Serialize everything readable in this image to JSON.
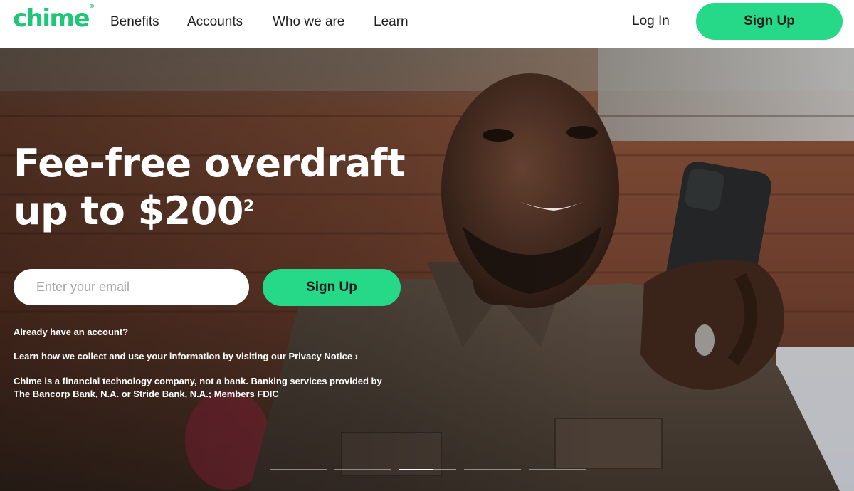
{
  "brand": {
    "logo_text": "chime",
    "logo_mark": "®",
    "accent_color": "#25d989"
  },
  "nav": {
    "links": [
      "Benefits",
      "Accounts",
      "Who we are",
      "Learn"
    ],
    "login_label": "Log In",
    "signup_label": "Sign Up"
  },
  "hero": {
    "headline_line1": "Fee-free overdraft",
    "headline_line2": "up to $200",
    "headline_footnote": "2",
    "email_placeholder": "Enter your email",
    "signup_label": "Sign Up",
    "already_account": "Already have an account?",
    "privacy_text": "Learn how we collect and use your information by visiting our Privacy Notice",
    "privacy_arrow": "›",
    "disclaimer_line1": "Chime is a financial technology company, not a bank. Banking services provided by",
    "disclaimer_line2": "The Bancorp Bank, N.A. or Stride Bank, N.A.; Members FDIC",
    "carousel": {
      "slide_count": 5,
      "active_index": 2
    }
  }
}
